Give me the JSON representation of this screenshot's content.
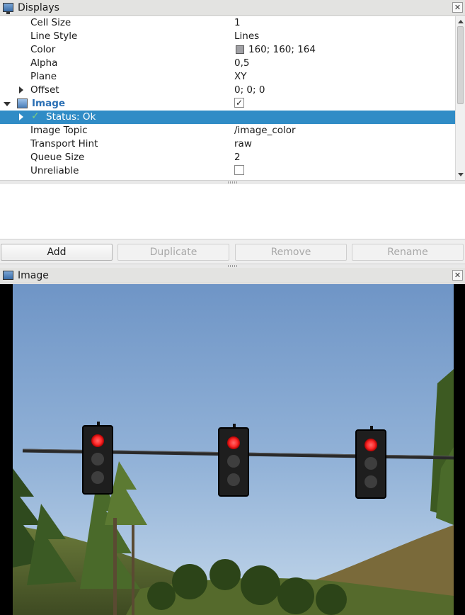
{
  "displays_panel": {
    "title": "Displays",
    "close_glyph": "✕",
    "rows": [
      {
        "label": "Cell Size",
        "value": "1"
      },
      {
        "label": "Line Style",
        "value": "Lines"
      },
      {
        "label": "Color",
        "value": "160; 160; 164",
        "swatch": "#a0a0a4"
      },
      {
        "label": "Alpha",
        "value": "0,5"
      },
      {
        "label": "Plane",
        "value": "XY"
      },
      {
        "label": "Offset",
        "value": "0; 0; 0"
      }
    ],
    "image_display": {
      "label": "Image",
      "enabled_glyph": "✓"
    },
    "status_row": {
      "check_glyph": "✓",
      "label": "Status: Ok"
    },
    "image_rows": [
      {
        "label": "Image Topic",
        "value": "/image_color"
      },
      {
        "label": "Transport Hint",
        "value": "raw"
      },
      {
        "label": "Queue Size",
        "value": "2"
      },
      {
        "label": "Unreliable",
        "value": ""
      }
    ]
  },
  "buttons": {
    "add": "Add",
    "duplicate": "Duplicate",
    "remove": "Remove",
    "rename": "Rename"
  },
  "image_panel": {
    "title": "Image",
    "close_glyph": "✕"
  },
  "colors": {
    "selection": "#308cc6",
    "link_blue": "#2a6fb4",
    "sky_top": "#6f95c6",
    "sky_bottom": "#c3d7ea",
    "red_light": "#ff2a2a"
  },
  "icons": [
    "monitor-icon",
    "image-icon",
    "close-icon",
    "expand-arrow-icon",
    "collapse-arrow-icon",
    "checkmark-icon",
    "checkbox"
  ]
}
